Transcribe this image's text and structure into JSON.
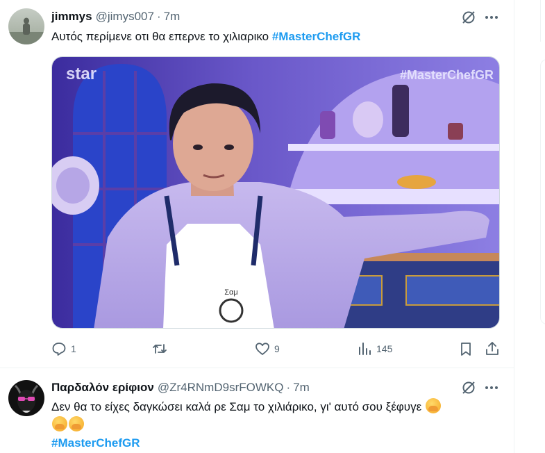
{
  "tweets": [
    {
      "author": {
        "name": "jimmys",
        "handle": "@jimys007",
        "avatar": "landscape-silhouette"
      },
      "time": "7m",
      "dot": "·",
      "text": "Αυτός περίμενε οτι θα επερνε το χιλιαρικο",
      "hashtag": "#MasterChefGR",
      "media": {
        "channel_logo": "star",
        "overlay_hashtag": "#MasterChefGR",
        "apron_text": "Σαμ"
      },
      "stats": {
        "replies": "1",
        "retweets": "",
        "likes": "9",
        "views": "145"
      }
    },
    {
      "author": {
        "name": "Παρδαλόν ερίφιον",
        "handle": "@Zr4RNmD9srFOWKQ",
        "avatar": "black-goat-sunglasses"
      },
      "time": "7m",
      "dot": "·",
      "text": "Δεν θα το είχες δαγκώσει καλά ρε Σαμ το χιλιάρικο, γι' αυτό σου ξέφυγε",
      "emojis": [
        "face-with-hand-over-mouth",
        "face-with-hand-over-mouth",
        "face-with-hand-over-mouth"
      ],
      "hashtag": "#MasterChefGR"
    }
  ],
  "colors": {
    "text": "#0f1419",
    "muted": "#536471",
    "link": "#1d9bf0",
    "border": "#eff3f4"
  }
}
